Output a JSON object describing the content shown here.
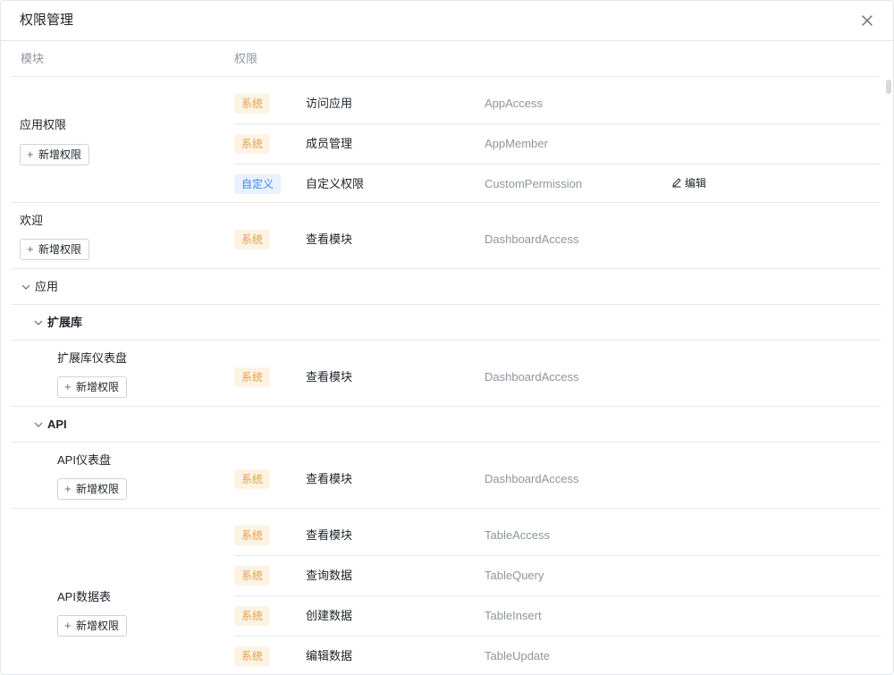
{
  "dialog": {
    "title": "权限管理"
  },
  "columns": {
    "module": "模块",
    "permission": "权限"
  },
  "add_label": "新增权限",
  "edit_label": "编辑",
  "sections": [
    {
      "module": "应用权限",
      "rows": [
        {
          "tag": "系统",
          "name": "访问应用",
          "code": "AppAccess"
        },
        {
          "tag": "系统",
          "name": "成员管理",
          "code": "AppMember"
        },
        {
          "tag": "自定义",
          "name": "自定义权限",
          "code": "CustomPermission"
        }
      ]
    },
    {
      "module": "欢迎",
      "rows": [
        {
          "tag": "系统",
          "name": "查看模块",
          "code": "DashboardAccess"
        }
      ]
    },
    {
      "module": "扩展库仪表盘",
      "rows": [
        {
          "tag": "系统",
          "name": "查看模块",
          "code": "DashboardAccess"
        }
      ]
    },
    {
      "module": "API仪表盘",
      "rows": [
        {
          "tag": "系统",
          "name": "查看模块",
          "code": "DashboardAccess"
        }
      ]
    },
    {
      "module": "API数据表",
      "rows": [
        {
          "tag": "系统",
          "name": "查看模块",
          "code": "TableAccess"
        },
        {
          "tag": "系统",
          "name": "查询数据",
          "code": "TableQuery"
        },
        {
          "tag": "系统",
          "name": "创建数据",
          "code": "TableInsert"
        },
        {
          "tag": "系统",
          "name": "编辑数据",
          "code": "TableUpdate"
        }
      ]
    }
  ],
  "groups": [
    {
      "name": "应用"
    },
    {
      "name": "扩展库"
    },
    {
      "name": "API"
    }
  ],
  "colors": {
    "system_tag_bg": "#fdf3e4",
    "system_tag_text": "#e4a149",
    "custom_tag_bg": "#e8f1fd",
    "custom_tag_text": "#3d87f3"
  }
}
